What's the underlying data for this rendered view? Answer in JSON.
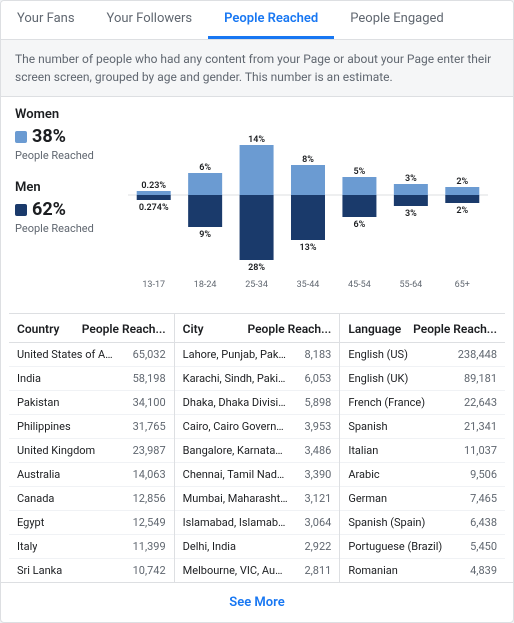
{
  "tabs": [
    {
      "label": "Your Fans",
      "active": false
    },
    {
      "label": "Your Followers",
      "active": false
    },
    {
      "label": "People Reached",
      "active": true
    },
    {
      "label": "People Engaged",
      "active": false
    }
  ],
  "description": "The number of people who had any content from your Page or about your Page enter their screen screen, grouped by age and gender. This number is an estimate.",
  "legend": {
    "women": {
      "title": "Women",
      "color": "#6b9bd2",
      "percent": "38%",
      "label": "People Reached"
    },
    "men": {
      "title": "Men",
      "color": "#1a3a6b",
      "percent": "62%",
      "label": "People Reached"
    }
  },
  "ageGroups": [
    {
      "age": "13-17",
      "women_pct": "0.23%",
      "men_pct": "0.274%",
      "women_h": 4,
      "men_h": 5
    },
    {
      "age": "18-24",
      "women_pct": "6%",
      "men_pct": "9%",
      "women_h": 22,
      "men_h": 32
    },
    {
      "age": "25-34",
      "women_pct": "14%",
      "men_pct": "28%",
      "women_h": 50,
      "men_h": 65
    },
    {
      "age": "35-44",
      "women_pct": "8%",
      "men_pct": "13%",
      "women_h": 30,
      "men_h": 45
    },
    {
      "age": "45-54",
      "women_pct": "5%",
      "men_pct": "6%",
      "women_h": 18,
      "men_h": 22
    },
    {
      "age": "55-64",
      "women_pct": "3%",
      "men_pct": "3%",
      "women_h": 11,
      "men_h": 11
    },
    {
      "age": "65+",
      "women_pct": "2%",
      "men_pct": "2%",
      "women_h": 8,
      "men_h": 8
    }
  ],
  "country_table": {
    "col1": "Country",
    "col2": "People Reach...",
    "rows": [
      {
        "name": "United States of America",
        "value": "65,032"
      },
      {
        "name": "India",
        "value": "58,198"
      },
      {
        "name": "Pakistan",
        "value": "34,100"
      },
      {
        "name": "Philippines",
        "value": "31,765"
      },
      {
        "name": "United Kingdom",
        "value": "23,987"
      },
      {
        "name": "Australia",
        "value": "14,063"
      },
      {
        "name": "Canada",
        "value": "12,856"
      },
      {
        "name": "Egypt",
        "value": "12,549"
      },
      {
        "name": "Italy",
        "value": "11,399"
      },
      {
        "name": "Sri Lanka",
        "value": "10,742"
      }
    ]
  },
  "city_table": {
    "col1": "City",
    "col2": "People Reach...",
    "rows": [
      {
        "name": "Lahore, Punjab, Pakistan",
        "value": "8,183"
      },
      {
        "name": "Karachi, Sindh, Pakistan",
        "value": "6,053"
      },
      {
        "name": "Dhaka, Dhaka Division,...",
        "value": "5,898"
      },
      {
        "name": "Cairo, Cairo Governora...",
        "value": "3,953"
      },
      {
        "name": "Bangalore, Karnataka,...",
        "value": "3,486"
      },
      {
        "name": "Chennai, Tamil Nadu, I...",
        "value": "3,390"
      },
      {
        "name": "Mumbai, Maharashtra,...",
        "value": "3,121"
      },
      {
        "name": "Islamabad, Islamabad ...",
        "value": "3,064"
      },
      {
        "name": "Delhi, India",
        "value": "2,922"
      },
      {
        "name": "Melbourne, VIC, Australia",
        "value": "2,811"
      }
    ]
  },
  "language_table": {
    "col1": "Language",
    "col2": "People Reach...",
    "rows": [
      {
        "name": "English (US)",
        "value": "238,448"
      },
      {
        "name": "English (UK)",
        "value": "89,181"
      },
      {
        "name": "French (France)",
        "value": "22,643"
      },
      {
        "name": "Spanish",
        "value": "21,341"
      },
      {
        "name": "Italian",
        "value": "11,037"
      },
      {
        "name": "Arabic",
        "value": "9,506"
      },
      {
        "name": "German",
        "value": "7,465"
      },
      {
        "name": "Spanish (Spain)",
        "value": "6,438"
      },
      {
        "name": "Portuguese (Brazil)",
        "value": "5,450"
      },
      {
        "name": "Romanian",
        "value": "4,839"
      }
    ]
  },
  "see_more": "See More"
}
